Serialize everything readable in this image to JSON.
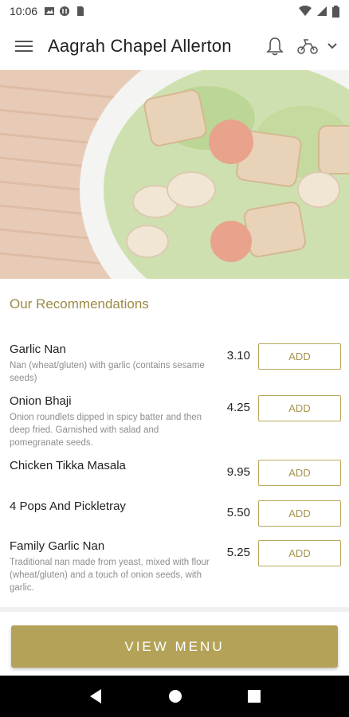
{
  "status_bar": {
    "time": "10:06",
    "icons": [
      "gallery-icon",
      "nfc-icon",
      "sim-icon",
      "wifi-icon",
      "signal-icon",
      "battery-icon"
    ]
  },
  "app_bar": {
    "title": "Aagrah Chapel Allerton",
    "icons": [
      "menu-icon",
      "bell-icon",
      "scooter-icon",
      "chevron-down-icon"
    ]
  },
  "section": {
    "title": "Our Recommendations"
  },
  "items": [
    {
      "name": "Garlic Nan",
      "description": "Nan (wheat/gluten) with garlic (contains sesame seeds)",
      "price": "3.10",
      "button": "ADD"
    },
    {
      "name": "Onion Bhaji",
      "description": "Onion roundlets dipped in spicy batter and then deep fried. Garnished with salad and pomegranate seeds.",
      "price": "4.25",
      "button": "ADD"
    },
    {
      "name": "Chicken Tikka Masala",
      "description": "",
      "price": "9.95",
      "button": "ADD"
    },
    {
      "name": "4 Pops And Pickletray",
      "description": "",
      "price": "5.50",
      "button": "ADD"
    },
    {
      "name": "Family Garlic Nan",
      "description": "Traditional nan made from yeast, mixed with flour (wheat/gluten) and a touch of onion seeds, with garlic.",
      "price": "5.25",
      "button": "ADD"
    }
  ],
  "view_menu_label": "VIEW MENU",
  "colors": {
    "accent": "#b3a258",
    "accent_text": "#9a8a45"
  }
}
